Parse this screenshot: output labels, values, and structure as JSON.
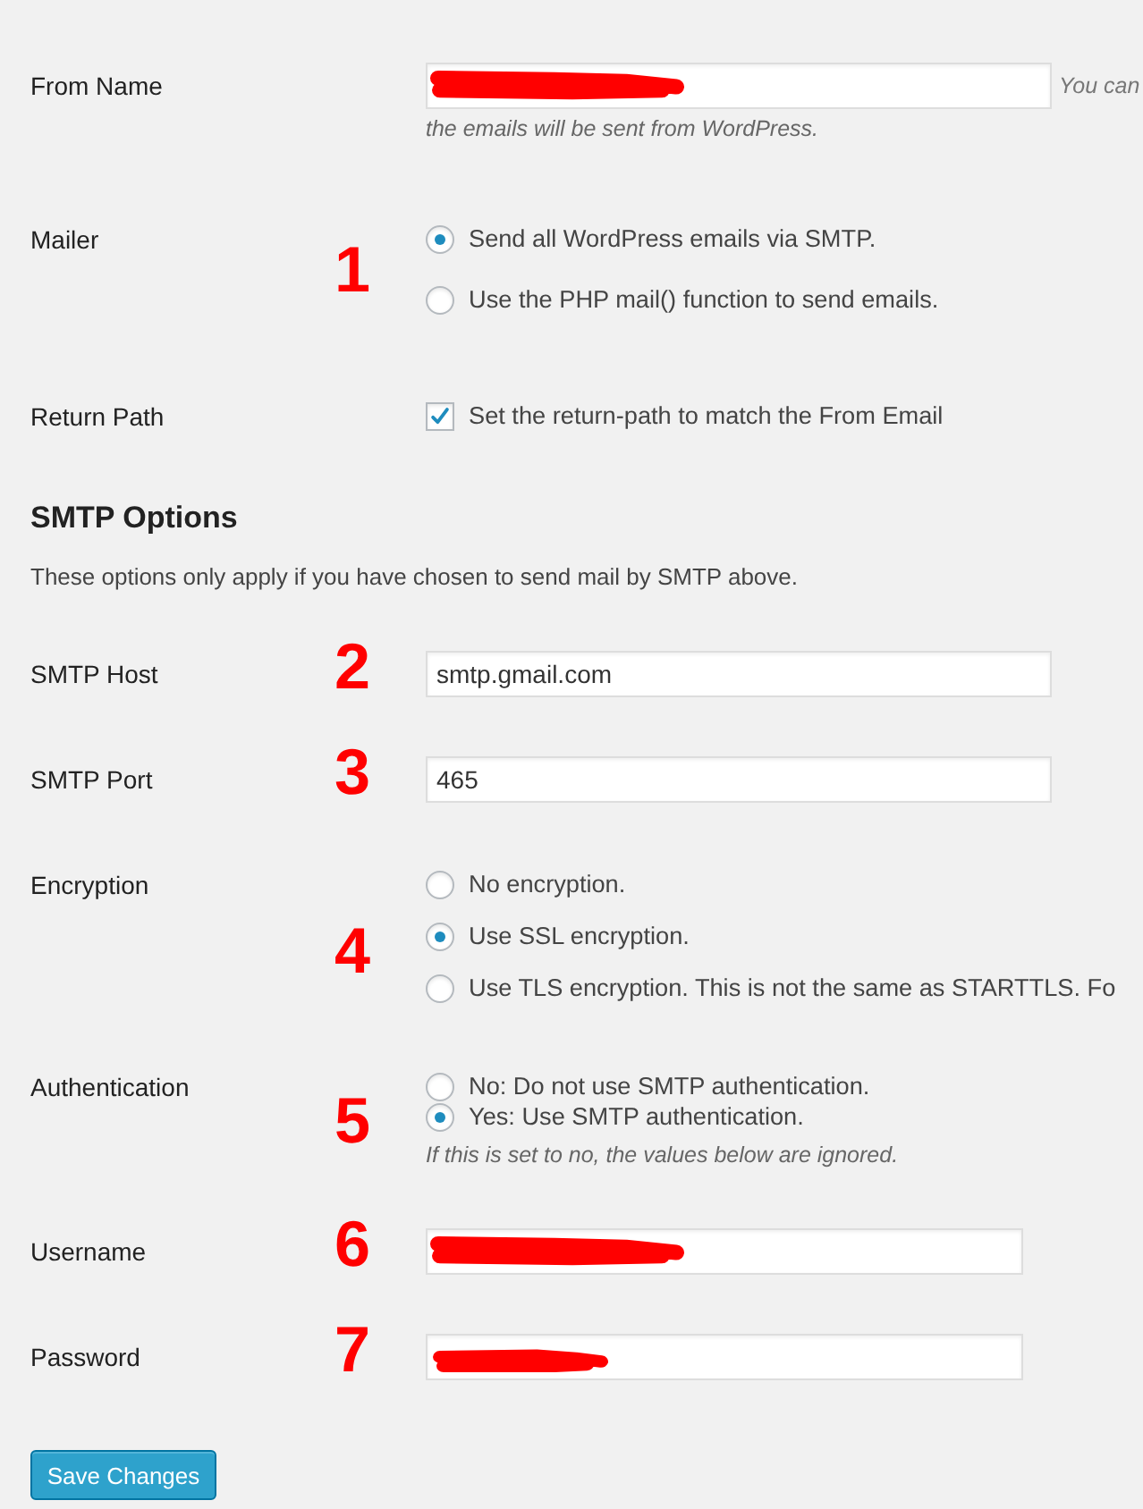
{
  "general_rows": [
    {
      "kind": "text",
      "label": "From Name",
      "redacted": true,
      "side_note": "You can",
      "description": "the emails will be sent from WordPress."
    },
    {
      "kind": "radio",
      "label": "Mailer",
      "annotation": "1",
      "options": [
        {
          "label": "Send all WordPress emails via SMTP.",
          "selected": true
        },
        {
          "label": "Use the PHP mail() function to send emails.",
          "selected": false
        }
      ]
    },
    {
      "kind": "checkbox",
      "label": "Return Path",
      "checked": true,
      "option": "Set the return-path to match the From Email"
    }
  ],
  "smtp_section": {
    "title": "SMTP Options",
    "description": "These options only apply if you have chosen to send mail by SMTP above.",
    "rows": [
      {
        "kind": "text",
        "label": "SMTP Host",
        "annotation": "2",
        "value": "smtp.gmail.com",
        "redacted": false
      },
      {
        "kind": "text",
        "label": "SMTP Port",
        "annotation": "3",
        "value": "465",
        "redacted": false
      },
      {
        "kind": "radio",
        "label": "Encryption",
        "annotation": "4",
        "options": [
          {
            "label": "No encryption.",
            "selected": false
          },
          {
            "label": "Use SSL encryption.",
            "selected": true
          },
          {
            "label": "Use TLS encryption. This is not the same as STARTTLS. Fo",
            "selected": false
          }
        ]
      },
      {
        "kind": "radio",
        "label": "Authentication",
        "annotation": "5",
        "options": [
          {
            "label": "No: Do not use SMTP authentication.",
            "selected": false
          },
          {
            "label": "Yes: Use SMTP authentication.",
            "selected": true
          }
        ],
        "description": "If this is set to no, the values below are ignored."
      },
      {
        "kind": "text",
        "label": "Username",
        "annotation": "6",
        "redacted": true
      },
      {
        "kind": "password",
        "label": "Password",
        "annotation": "7",
        "redacted": true
      }
    ]
  },
  "save_button": "Save Changes"
}
